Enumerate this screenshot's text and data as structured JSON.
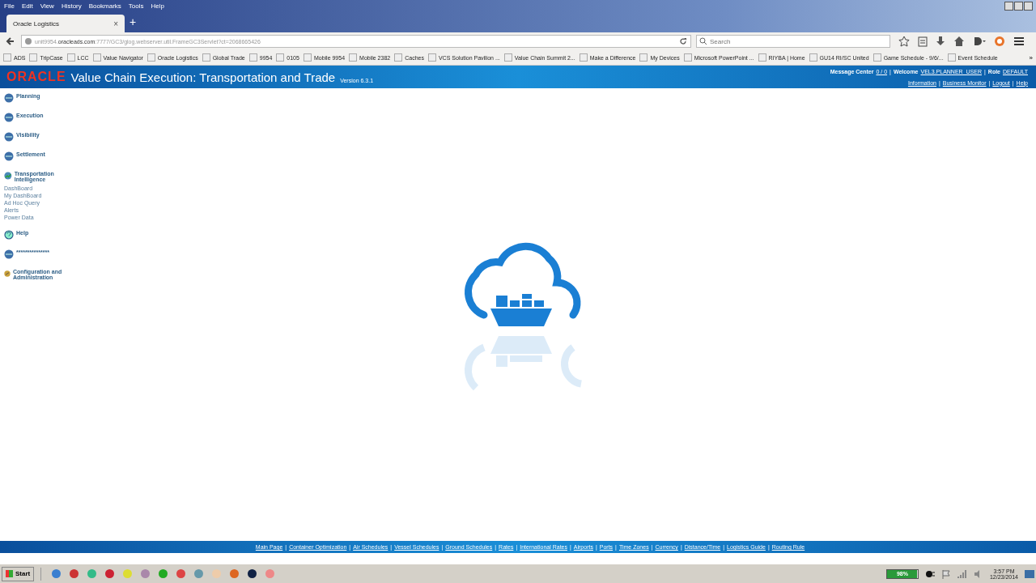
{
  "menu": [
    "File",
    "Edit",
    "View",
    "History",
    "Bookmarks",
    "Tools",
    "Help"
  ],
  "tabs": [
    {
      "label": "Oracle Logistics",
      "selected": true
    }
  ],
  "tab_close": "×",
  "new_tab": "+",
  "separator": "|",
  "url": {
    "host": "unit9954.",
    "domain": "oracleads.com",
    "path": ":7777/GC3/glog.webserver.util.FrameGC3Servlet?ct=2068665426"
  },
  "search": {
    "placeholder": "Search"
  },
  "bookmarks": [
    "ADS",
    "TripCase",
    "LCC",
    "Value Navigator",
    "Oracle Logistics",
    "Global Trade",
    "9954",
    "0105",
    "Mobile 9954",
    "Mobile 2382",
    "Caches",
    "VCS Solution Pavilion ...",
    "Value Chain Summit 2...",
    "Make a Difference",
    "My Devices",
    "Microsoft PowerPoint ...",
    "RIYBA | Home",
    "GU14 RI/SC United",
    "Game Schedule - 9/6/...",
    "Event Schedule"
  ],
  "bookmarks_more": "»",
  "app": {
    "logo": "ORACLE",
    "title": "Value Chain Execution: Transportation and Trade",
    "version": "Version 6.3.1",
    "message_center": "Message Center",
    "messages": "0 / 0",
    "welcome": "Welcome",
    "user": "VEL3.PLANNER_USER",
    "role_label": "Role",
    "role": "DEFAULT",
    "links": [
      "Information",
      "Business Monitor",
      "Logout",
      "Help"
    ]
  },
  "sidebar": [
    {
      "kind": "otm",
      "label": "Planning"
    },
    {
      "kind": "otm",
      "label": "Execution"
    },
    {
      "kind": "otm",
      "label": "Visibility"
    },
    {
      "kind": "otm",
      "label": "Settlement"
    },
    {
      "kind": "intelligence",
      "label": "Transportation Intelligence",
      "children": [
        "DashBoard",
        "My DashBoard",
        "Ad Hoc Query",
        "Alerts",
        "Power Data"
      ]
    },
    {
      "kind": "help",
      "label": "Help"
    },
    {
      "kind": "otm",
      "label": "***************"
    },
    {
      "kind": "config",
      "label": "Configuration and Administration"
    }
  ],
  "footer_links": [
    "Main Page",
    "Container Optimization",
    "Air Schedules",
    "Vessel Schedules",
    "Ground Schedules",
    "Rates",
    "International Rates",
    "Airports",
    "Ports",
    "Time Zones",
    "Currency",
    "Distance/Time",
    "Logistics Guide",
    "Routing Rule"
  ],
  "taskbar": {
    "start": "Start",
    "battery": {
      "reading": "98%",
      "level": 0.98
    },
    "time": "3:57 PM",
    "date": "12/23/2014"
  }
}
